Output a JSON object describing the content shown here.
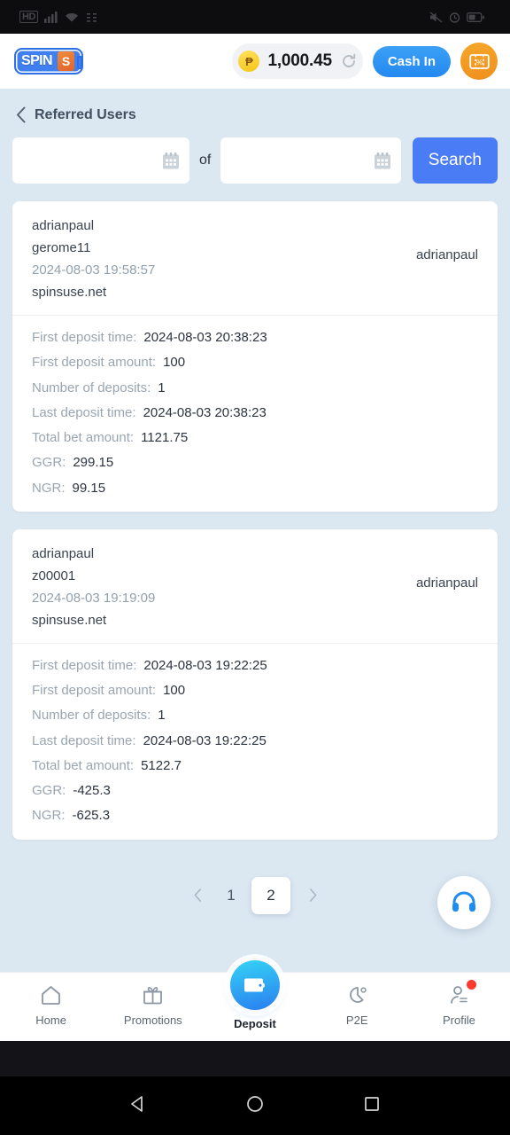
{
  "statusbar": {
    "battery_pct": ""
  },
  "header": {
    "logo_text": "SPIN",
    "logo_accent": "S",
    "balance": "1,000.45",
    "currency_symbol": "₱",
    "cash_in_label": "Cash In",
    "colors": {
      "accent_blue": "#2489f0",
      "voucher_orange": "#ee8f1d",
      "coin_yellow": "#f5c518"
    }
  },
  "breadcrumb": {
    "title": "Referred Users"
  },
  "search": {
    "date_from": "",
    "date_to": "",
    "separator": "of",
    "button_label": "Search",
    "button_color": "#4a7df5"
  },
  "cards": [
    {
      "owner": "adrianpaul",
      "username": "gerome11",
      "registered_at": "2024-08-03 19:58:57",
      "domain": "spinsuse.net",
      "referrer": "adrianpaul",
      "stats": [
        {
          "label": "First deposit time:",
          "value": "2024-08-03 20:38:23"
        },
        {
          "label": "First deposit amount:",
          "value": "100"
        },
        {
          "label": "Number of deposits:",
          "value": "1"
        },
        {
          "label": "Last deposit time:",
          "value": "2024-08-03 20:38:23"
        },
        {
          "label": "Total bet amount:",
          "value": "1121.75"
        },
        {
          "label": "GGR:",
          "value": "299.15"
        },
        {
          "label": "NGR:",
          "value": "99.15"
        }
      ]
    },
    {
      "owner": "adrianpaul",
      "username": "z00001",
      "registered_at": "2024-08-03 19:19:09",
      "domain": "spinsuse.net",
      "referrer": "adrianpaul",
      "stats": [
        {
          "label": "First deposit time:",
          "value": "2024-08-03 19:22:25"
        },
        {
          "label": "First deposit amount:",
          "value": "100"
        },
        {
          "label": "Number of deposits:",
          "value": "1"
        },
        {
          "label": "Last deposit time:",
          "value": "2024-08-03 19:22:25"
        },
        {
          "label": "Total bet amount:",
          "value": "5122.7"
        },
        {
          "label": "GGR:",
          "value": "-425.3"
        },
        {
          "label": "NGR:",
          "value": "-625.3"
        }
      ]
    }
  ],
  "pagination": {
    "pages": [
      "1",
      "2"
    ],
    "active_page": "2"
  },
  "support": {
    "icon": "headphones-icon"
  },
  "bottomnav": {
    "items": [
      {
        "label": "Home",
        "icon": "home-icon",
        "active": false
      },
      {
        "label": "Promotions",
        "icon": "gift-icon",
        "active": false
      },
      {
        "label": "Deposit",
        "icon": "wallet-icon",
        "active": true
      },
      {
        "label": "P2E",
        "icon": "p2e-icon",
        "active": false
      },
      {
        "label": "Profile",
        "icon": "person-icon",
        "active": false
      }
    ]
  }
}
